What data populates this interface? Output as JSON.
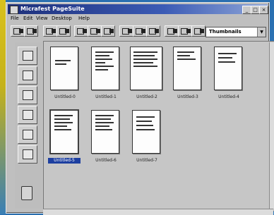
{
  "window": {
    "title": "Micrafest PageSuite"
  },
  "title_buttons": [
    "_",
    "□",
    "×"
  ],
  "menu": [
    "File",
    "Edit",
    "View",
    "Desktop",
    "Help"
  ],
  "view_select": {
    "value": "Thumbnails"
  },
  "thumbnails": [
    {
      "label": "Untitled-0"
    },
    {
      "label": "Untitled-1"
    },
    {
      "label": "Untitled-2"
    },
    {
      "label": "Untitled-3"
    },
    {
      "label": "Untitled-4"
    },
    {
      "label": "Untitled-5",
      "selected": true
    },
    {
      "label": "Untitled-6"
    },
    {
      "label": "Untitled-7"
    }
  ],
  "toolbar_icons": [
    "fax-icon",
    "printer-icon",
    "scanner-icon",
    "copy-icon",
    "page-icon",
    "zoom-icon",
    "tool-icon",
    "split-icon",
    "merge-icon",
    "rotate-icon",
    "cut-icon",
    "stamp-icon",
    "flag-icon",
    "help-icon"
  ],
  "sidebar_icons": [
    "fax-machine-icon",
    "printer-icon",
    "scanner-icon",
    "pen-icon",
    "mail-icon",
    "attachment-icon"
  ],
  "colors": {
    "titlebar_start": "#1d2f7a",
    "titlebar_end": "#8fa6d8",
    "selection": "#1d3fa0"
  }
}
